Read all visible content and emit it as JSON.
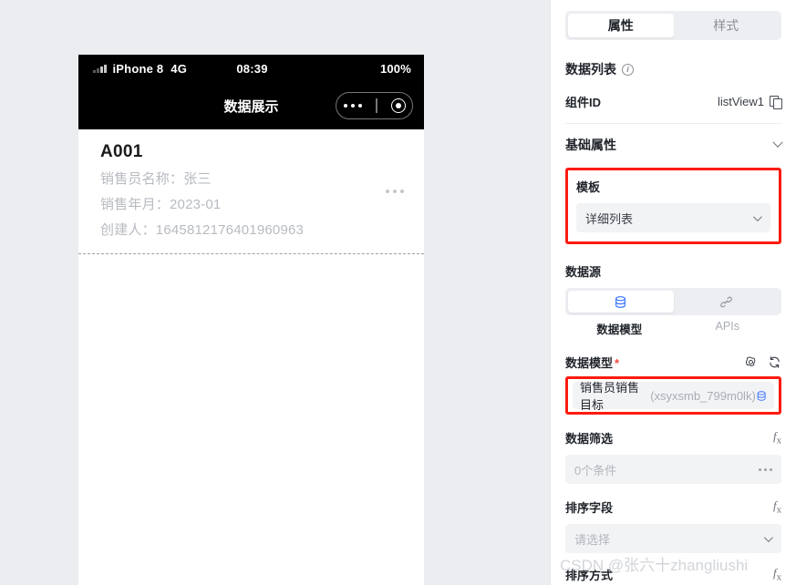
{
  "canvas": {
    "phone": {
      "status_bar": {
        "signal_icon": "signal-bars-icon",
        "carrier": "iPhone 8",
        "network": "4G",
        "time": "08:39",
        "battery": "100%"
      },
      "nav_bar": {
        "title": "数据展示",
        "capsule": {
          "more_icon": "more-dots-icon",
          "target_icon": "target-circle-icon"
        }
      },
      "list": {
        "cards": [
          {
            "title": "A001",
            "lines": [
              "销售员名称：张三",
              "销售年月：2023-01",
              "创建人：1645812176401960963"
            ],
            "more_icon": "more-dots-icon"
          }
        ]
      }
    }
  },
  "panel": {
    "tabs": [
      {
        "label": "属性",
        "active": true
      },
      {
        "label": "样式",
        "active": false
      }
    ],
    "component": {
      "title": "数据列表",
      "info_icon": "info-circle-icon",
      "id_label": "组件ID",
      "id_value": "listView1",
      "copy_icon": "copy-icon"
    },
    "basic_section": {
      "title": "基础属性",
      "chevron_icon": "chevron-down-icon"
    },
    "template": {
      "label": "模板",
      "value": "详细列表",
      "chevron_icon": "chevron-down-icon",
      "highlight_color": "#fc1b0f"
    },
    "data_source": {
      "label": "数据源",
      "options": [
        {
          "label": "数据模型",
          "icon": "database-icon",
          "active": true
        },
        {
          "label": "APIs",
          "icon": "api-link-icon",
          "active": false
        }
      ]
    },
    "data_model": {
      "label": "数据模型",
      "required_mark": "*",
      "settings_icon": "gear-icon",
      "refresh_icon": "refresh-icon",
      "value_name": "销售员销售目标",
      "value_code": "(xsyxsmb_799m0lk)",
      "trailing_icon": "database-icon",
      "highlight_color": "#fc1b0f"
    },
    "data_filter": {
      "label": "数据筛选",
      "fx_icon": "fx-icon",
      "value": "0个条件",
      "more_icon": "more-dots-icon"
    },
    "sort_field": {
      "label": "排序字段",
      "fx_icon": "fx-icon",
      "placeholder": "请选择",
      "chevron_icon": "chevron-down-icon"
    },
    "sort_mode": {
      "label": "排序方式",
      "fx_icon": "fx-icon"
    }
  },
  "watermark": {
    "text": "CSDN @张六十zhangliushi"
  }
}
